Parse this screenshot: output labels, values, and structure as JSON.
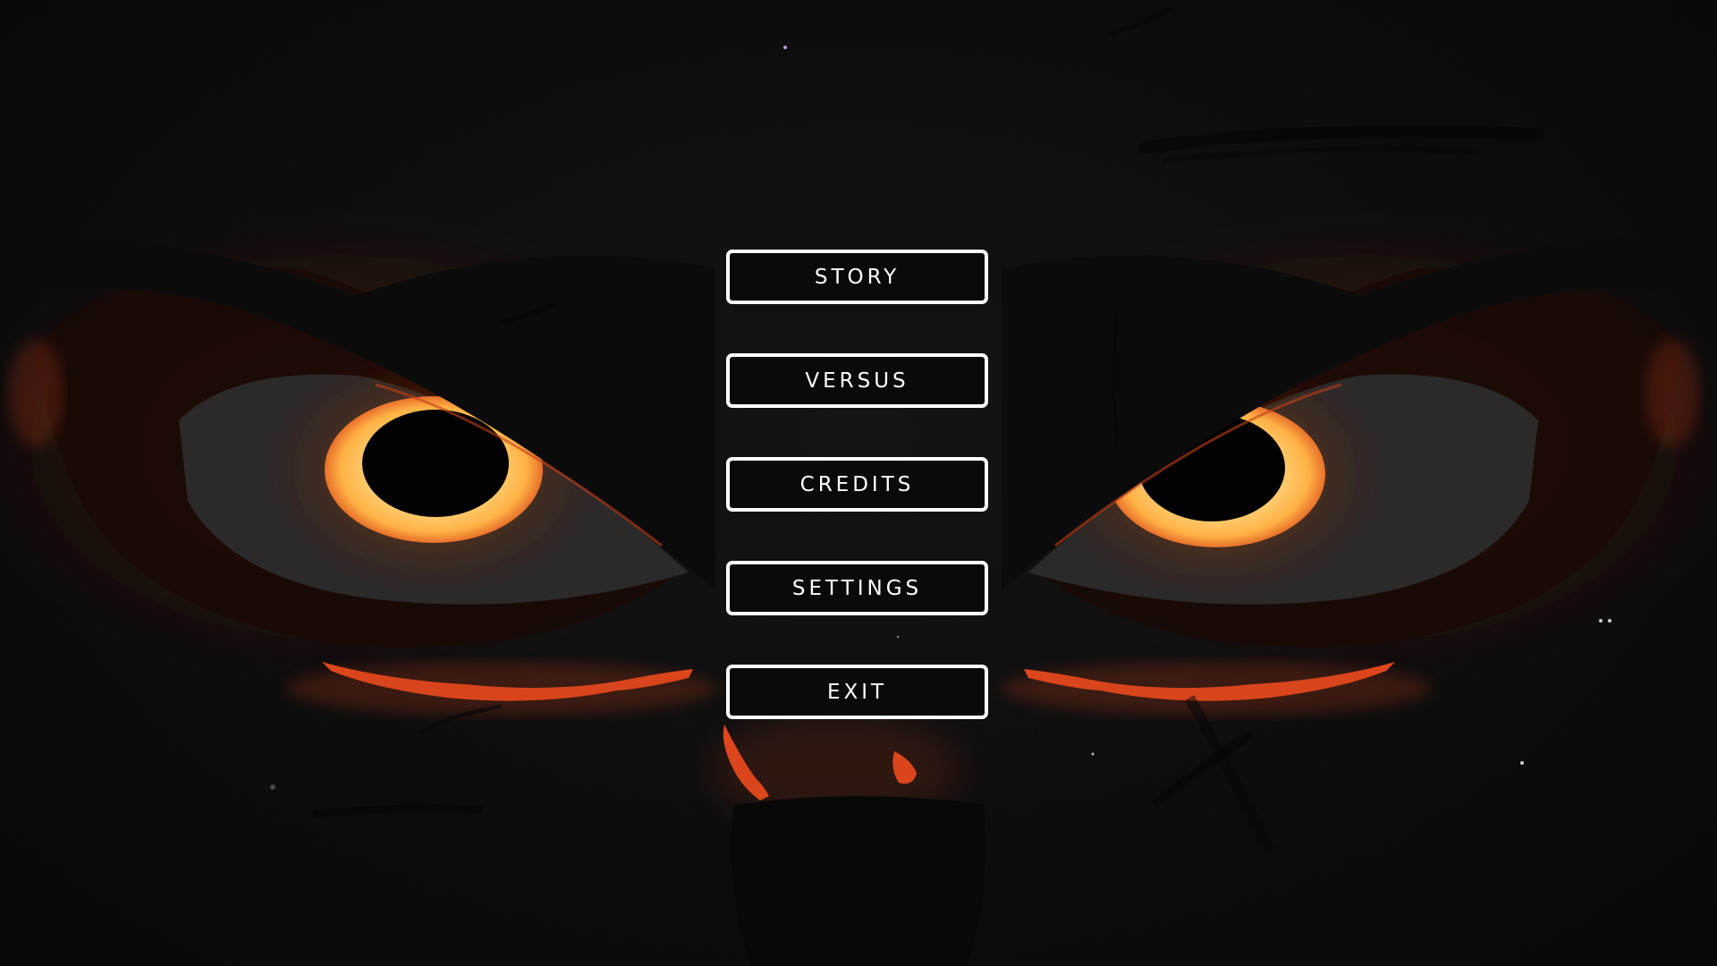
{
  "menu": {
    "items": [
      {
        "id": "story",
        "label": "STORY"
      },
      {
        "id": "versus",
        "label": "VERSUS"
      },
      {
        "id": "credits",
        "label": "CREDITS"
      },
      {
        "id": "settings",
        "label": "SETTINGS"
      },
      {
        "id": "exit",
        "label": "EXIT"
      }
    ]
  },
  "colors": {
    "background": "#0c0c0c",
    "glow": "#c2401a",
    "iris": "#ffd27a",
    "button_border": "#ffffff",
    "button_text": "#ffffff"
  }
}
